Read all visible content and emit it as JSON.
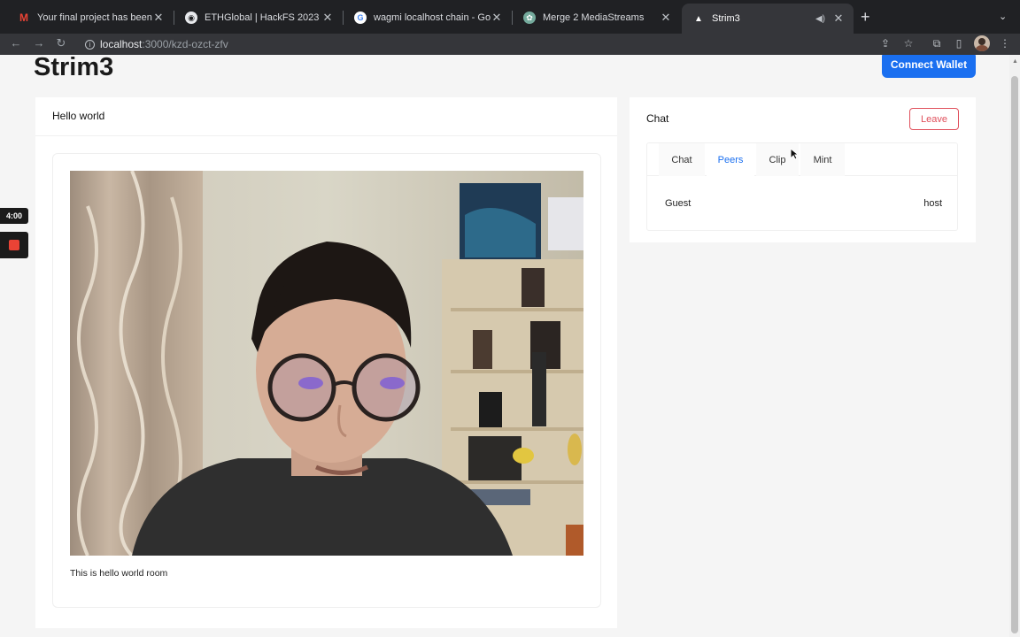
{
  "browser": {
    "tabs": [
      {
        "title": "Your final project has been app",
        "favicon": "gmail-icon",
        "active": false
      },
      {
        "title": "ETHGlobal | HackFS 2023",
        "favicon": "ethglobal-icon",
        "active": false
      },
      {
        "title": "wagmi localhost chain - Google",
        "favicon": "google-icon",
        "active": false
      },
      {
        "title": "Merge 2 MediaStreams",
        "favicon": "chatgpt-icon",
        "active": false
      },
      {
        "title": "Strim3",
        "favicon": "triangle-icon",
        "active": true,
        "muted_icon": "speaker-icon"
      }
    ],
    "address": {
      "host": "localhost",
      "path": ":3000/kzd-ozct-zfv"
    }
  },
  "app": {
    "title": "Strim3",
    "connect_label": "Connect Wallet"
  },
  "room": {
    "name": "Hello world",
    "description": "This is hello world room"
  },
  "chat_panel": {
    "title": "Chat",
    "leave_label": "Leave",
    "tabs": [
      {
        "label": "Chat",
        "selected": false
      },
      {
        "label": "Peers",
        "selected": true
      },
      {
        "label": "Clip",
        "selected": false
      },
      {
        "label": "Mint",
        "selected": false
      }
    ],
    "peers": [
      {
        "name": "Guest",
        "role": "host"
      }
    ]
  },
  "recorder": {
    "timer": "4:00"
  },
  "colors": {
    "accent": "#1a6ff0",
    "danger": "#e0505c"
  }
}
